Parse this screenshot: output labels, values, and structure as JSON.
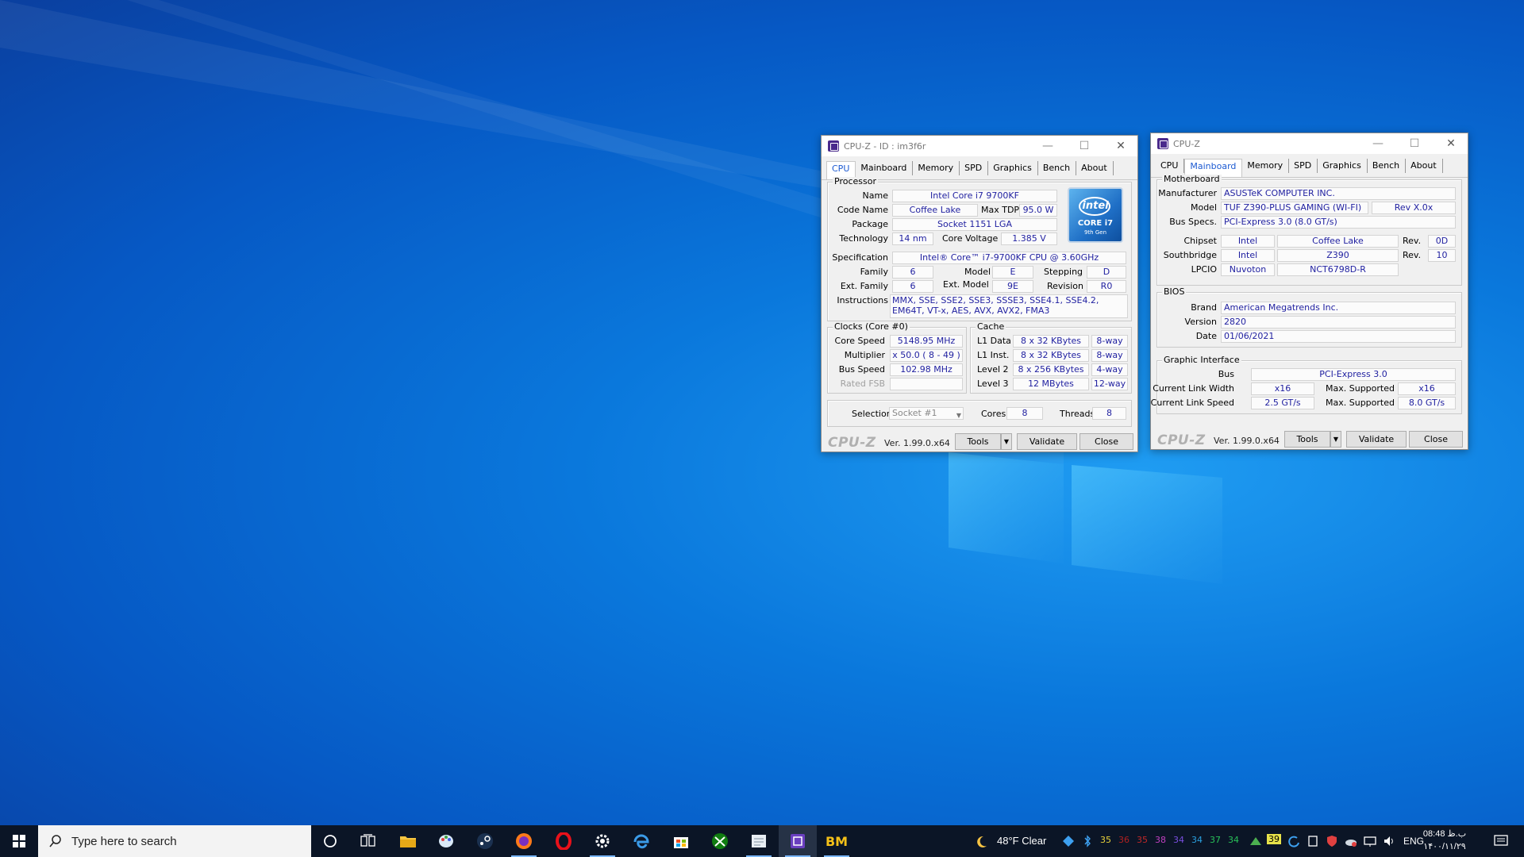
{
  "colors": {
    "accent": "#1c5ad2",
    "value_text": "#1f1fa0",
    "taskbar": "#0b1526"
  },
  "cpu_window": {
    "title": "CPU-Z - ID : im3f6r",
    "tabs": [
      "CPU",
      "Mainboard",
      "Memory",
      "SPD",
      "Graphics",
      "Bench",
      "About"
    ],
    "active_tab": "CPU",
    "processor": {
      "group": "Processor",
      "name_label": "Name",
      "name": "Intel Core i7 9700KF",
      "codename_label": "Code Name",
      "codename": "Coffee Lake",
      "maxtdp_label": "Max TDP",
      "maxtdp": "95.0 W",
      "package_label": "Package",
      "package": "Socket 1151 LGA",
      "technology_label": "Technology",
      "technology": "14 nm",
      "corevoltage_label": "Core Voltage",
      "corevoltage": "1.385 V",
      "spec_label": "Specification",
      "spec": "Intel® Core™ i7-9700KF CPU @ 3.60GHz",
      "family_label": "Family",
      "family": "6",
      "model_label": "Model",
      "model": "E",
      "stepping_label": "Stepping",
      "stepping": "D",
      "extfamily_label": "Ext. Family",
      "extfamily": "6",
      "extmodel_label": "Ext. Model",
      "extmodel": "9E",
      "revision_label": "Revision",
      "revision": "R0",
      "instructions_label": "Instructions",
      "instructions": "MMX, SSE, SSE2, SSE3, SSSE3, SSE4.1, SSE4.2, EM64T, VT-x, AES, AVX, AVX2, FMA3",
      "logo": {
        "brand": "intel",
        "line1": "CORE i7",
        "line2": "9th Gen"
      }
    },
    "clocks": {
      "group": "Clocks (Core #0)",
      "corespeed_label": "Core Speed",
      "corespeed": "5148.95 MHz",
      "multiplier_label": "Multiplier",
      "multiplier": "x 50.0 ( 8 - 49 )",
      "busspeed_label": "Bus Speed",
      "busspeed": "102.98 MHz",
      "ratedfsb_label": "Rated FSB",
      "ratedfsb": ""
    },
    "cache": {
      "group": "Cache",
      "l1data_label": "L1 Data",
      "l1data": "8 x 32 KBytes",
      "l1data_way": "8-way",
      "l1inst_label": "L1 Inst.",
      "l1inst": "8 x 32 KBytes",
      "l1inst_way": "8-way",
      "l2_label": "Level 2",
      "l2": "8 x 256 KBytes",
      "l2_way": "4-way",
      "l3_label": "Level 3",
      "l3": "12 MBytes",
      "l3_way": "12-way"
    },
    "selection_label": "Selection",
    "selection": "Socket #1",
    "cores_label": "Cores",
    "cores": "8",
    "threads_label": "Threads",
    "threads": "8",
    "brand": "CPU-Z",
    "version": "Ver. 1.99.0.x64",
    "tools": "Tools",
    "validate": "Validate",
    "close": "Close"
  },
  "mb_window": {
    "title": "CPU-Z",
    "tabs": [
      "CPU",
      "Mainboard",
      "Memory",
      "SPD",
      "Graphics",
      "Bench",
      "About"
    ],
    "active_tab": "Mainboard",
    "motherboard": {
      "group": "Motherboard",
      "manufacturer_label": "Manufacturer",
      "manufacturer": "ASUSTeK COMPUTER INC.",
      "model_label": "Model",
      "model": "TUF Z390-PLUS GAMING (WI-FI)",
      "model_rev": "Rev X.0x",
      "busspecs_label": "Bus Specs.",
      "busspecs": "PCI-Express 3.0 (8.0 GT/s)",
      "chipset_label": "Chipset",
      "chipset_vendor": "Intel",
      "chipset_name": "Coffee Lake",
      "chipset_rev_label": "Rev.",
      "chipset_rev": "0D",
      "southbridge_label": "Southbridge",
      "sb_vendor": "Intel",
      "sb_name": "Z390",
      "sb_rev_label": "Rev.",
      "sb_rev": "10",
      "lpcio_label": "LPCIO",
      "lpcio_vendor": "Nuvoton",
      "lpcio_name": "NCT6798D-R"
    },
    "bios": {
      "group": "BIOS",
      "brand_label": "Brand",
      "brand": "American Megatrends Inc.",
      "version_label": "Version",
      "version": "2820",
      "date_label": "Date",
      "date": "01/06/2021"
    },
    "graphic": {
      "group": "Graphic Interface",
      "bus_label": "Bus",
      "bus": "PCI-Express 3.0",
      "clw_label": "Current Link Width",
      "clw": "x16",
      "maxsup1_label": "Max. Supported",
      "maxsup1": "x16",
      "cls_label": "Current Link Speed",
      "cls": "2.5 GT/s",
      "maxsup2_label": "Max. Supported",
      "maxsup2": "8.0 GT/s"
    },
    "brand": "CPU-Z",
    "version": "Ver. 1.99.0.x64",
    "tools": "Tools",
    "validate": "Validate",
    "close": "Close"
  },
  "taskbar": {
    "search_placeholder": "Type here to search",
    "apps": [
      "cortana-icon",
      "task-view-icon",
      "file-explorer-icon",
      "paint-icon",
      "steam-icon",
      "firefox-icon",
      "opera-icon",
      "settings-icon",
      "edge-icon",
      "store-icon",
      "xbox-icon",
      "notepad-icon",
      "cpuz-icon",
      "bm-icon"
    ],
    "bm_label": "BM",
    "weather": "48°F  Clear",
    "tray_numbers": [
      {
        "value": "35",
        "color": "#e8d23a"
      },
      {
        "value": "36",
        "color": "#b02020"
      },
      {
        "value": "35",
        "color": "#c02828"
      },
      {
        "value": "38",
        "color": "#c040c0"
      },
      {
        "value": "34",
        "color": "#7a4ee0"
      },
      {
        "value": "34",
        "color": "#2aa0e0"
      },
      {
        "value": "37",
        "color": "#28c058"
      },
      {
        "value": "34",
        "color": "#28c058"
      }
    ],
    "badge": "39",
    "lang": "ENG",
    "time": "08:48 ب.ظ",
    "date": "۱۴۰۰/۱۱/۲۹"
  }
}
